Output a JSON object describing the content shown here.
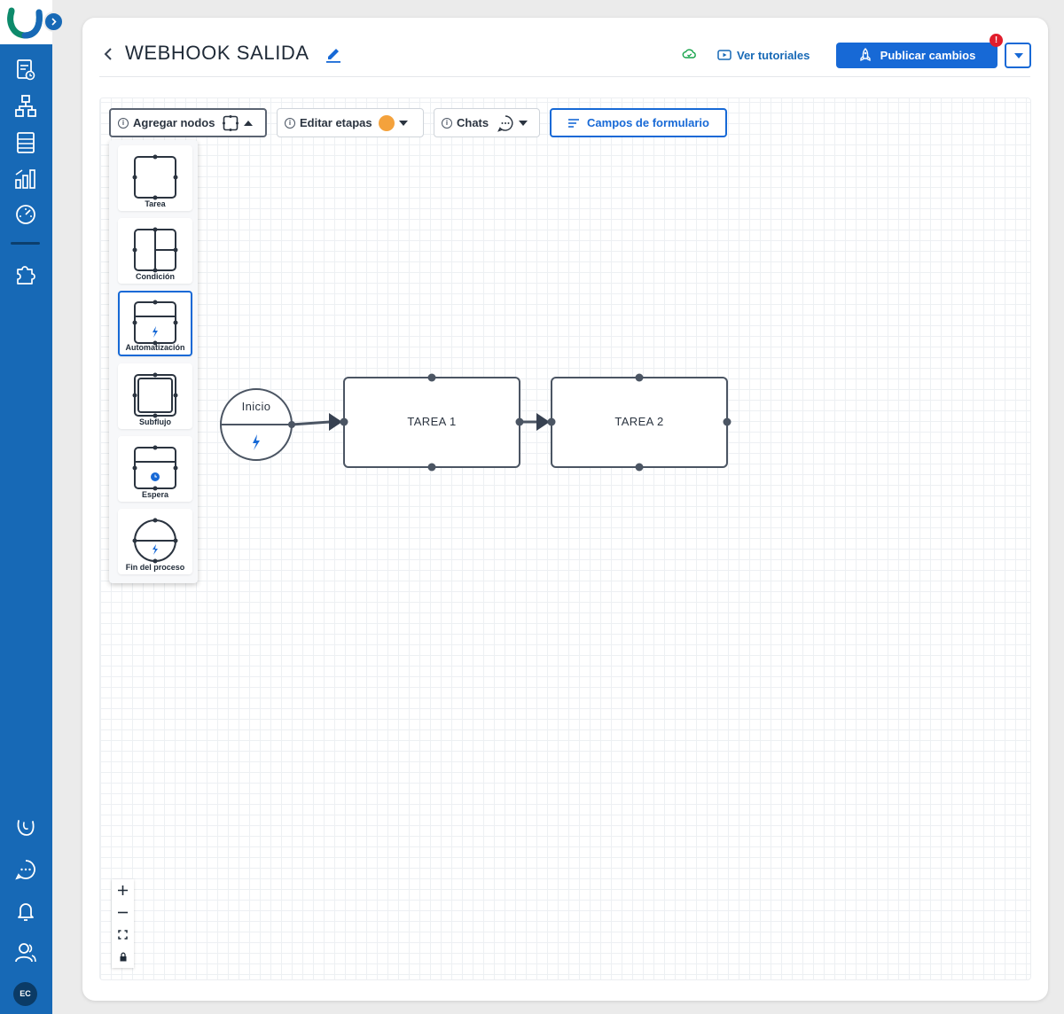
{
  "header": {
    "title": "WEBHOOK SALIDA",
    "tutorials_label": "Ver tutoriales",
    "publish_label": "Publicar cambios",
    "alert_badge": "!"
  },
  "toolbar": {
    "add_nodes_label": "Agregar nodos",
    "edit_stages_label": "Editar etapas",
    "chats_label": "Chats",
    "form_fields_label": "Campos de formulario",
    "info_glyph": "i"
  },
  "palette": {
    "items": [
      {
        "label": "Tarea",
        "icon": "task-node-icon"
      },
      {
        "label": "Condición",
        "icon": "condition-node-icon"
      },
      {
        "label": "Automatización",
        "icon": "automation-node-icon"
      },
      {
        "label": "Subflujo",
        "icon": "subflow-node-icon"
      },
      {
        "label": "Espera",
        "icon": "wait-node-icon"
      },
      {
        "label": "Fin del proceso",
        "icon": "end-process-node-icon"
      }
    ]
  },
  "flow": {
    "start_label": "Inicio",
    "nodes": [
      "TAREA 1",
      "TAREA 2"
    ]
  },
  "user": {
    "initials": "EC"
  },
  "colors": {
    "sidebar": "#1769b6",
    "primary": "#1769d6",
    "alert": "#e11d2c",
    "stage_dot": "#f4a23c"
  }
}
